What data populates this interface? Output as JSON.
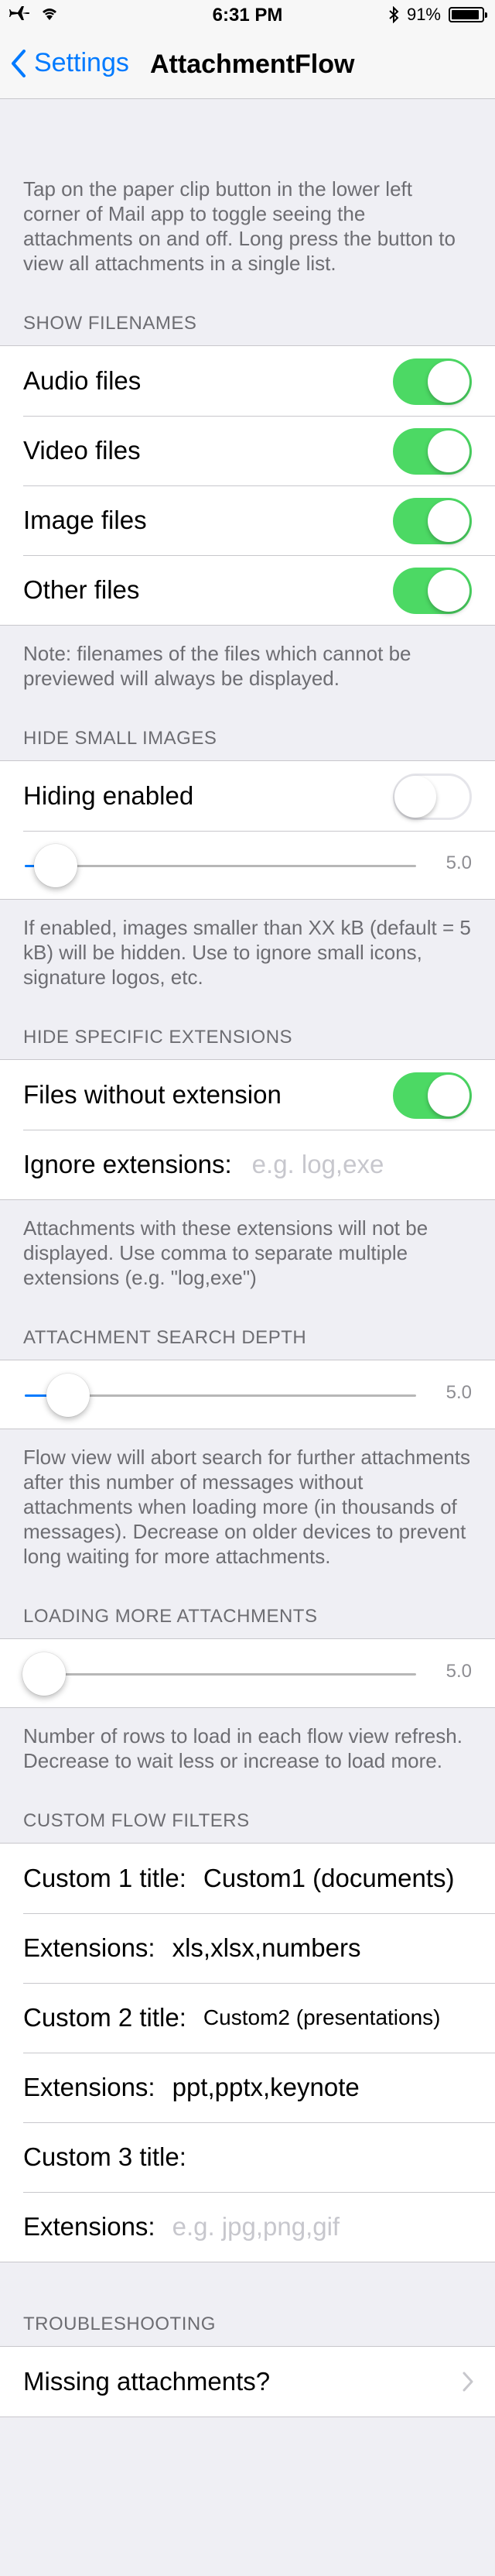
{
  "status_bar": {
    "time": "6:31 PM",
    "battery_label": "91%",
    "battery_level": 0.91
  },
  "nav": {
    "back_label": "Settings",
    "title": "AttachmentFlow"
  },
  "intro_note": "Tap on the paper clip button in the lower left corner of Mail app to toggle seeing the attachments on and off. Long press the button to view all attachments in a single list.",
  "show_filenames": {
    "header": "SHOW FILENAMES",
    "rows": [
      {
        "label": "Audio files",
        "on": true
      },
      {
        "label": "Video files",
        "on": true
      },
      {
        "label": "Image files",
        "on": true
      },
      {
        "label": "Other files",
        "on": true
      }
    ],
    "note": "Note: filenames of the files which cannot be previewed will always be displayed."
  },
  "hide_small_images": {
    "header": "HIDE SMALL IMAGES",
    "toggle_label": "Hiding enabled",
    "toggle_on": false,
    "slider_value": "5.0",
    "slider_fraction": 0.08,
    "note": "If enabled, images smaller than XX kB (default = 5 kB) will be hidden. Use to ignore small icons, signature logos, etc."
  },
  "hide_specific_extensions": {
    "header": "HIDE SPECIFIC EXTENSIONS",
    "toggle_label": "Files without extension",
    "toggle_on": true,
    "ignore_label": "Ignore extensions:",
    "ignore_placeholder": "e.g. log,exe",
    "note": "Attachments with these extensions will not be displayed. Use comma to separate multiple extensions (e.g. \"log,exe\")"
  },
  "attachment_search_depth": {
    "header": "ATTACHMENT SEARCH DEPTH",
    "slider_value": "5.0",
    "slider_fraction": 0.11,
    "note": "Flow view will abort search for further attachments after this number of messages without attachments when loading more (in thousands of messages). Decrease on older devices to prevent long waiting for more attachments."
  },
  "loading_more": {
    "header": "LOADING MORE ATTACHMENTS",
    "slider_value": "5.0",
    "slider_fraction": 0.05,
    "note": "Number of rows to load in each flow view refresh. Decrease to wait less or increase to load more."
  },
  "custom_flow_filters": {
    "header": "CUSTOM FLOW FILTERS",
    "rows": [
      {
        "label": "Custom 1 title:",
        "value": "Custom1 (documents)",
        "placeholder": ""
      },
      {
        "label": "Extensions:",
        "value": "xls,xlsx,numbers",
        "placeholder": ""
      },
      {
        "label": "Custom 2 title:",
        "value": "Custom2 (presentations)",
        "placeholder": ""
      },
      {
        "label": "Extensions:",
        "value": "ppt,pptx,keynote",
        "placeholder": ""
      },
      {
        "label": "Custom 3 title:",
        "value": "",
        "placeholder": ""
      },
      {
        "label": "Extensions:",
        "value": "",
        "placeholder": "e.g. jpg,png,gif"
      }
    ]
  },
  "troubleshooting": {
    "header": "TROUBLESHOOTING",
    "row_label": "Missing attachments?"
  },
  "colors": {
    "accent": "#007aff",
    "toggle_on": "#4cd964",
    "background": "#efeff4"
  }
}
